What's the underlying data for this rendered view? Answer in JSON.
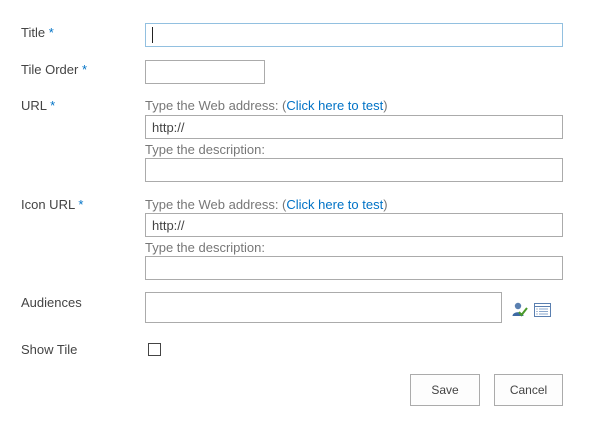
{
  "form": {
    "title": {
      "label": "Title",
      "required_mark": "*",
      "value": ""
    },
    "tile_order": {
      "label": "Tile Order",
      "required_mark": "*",
      "value": ""
    },
    "url": {
      "label": "URL",
      "required_mark": "*",
      "address_hint_prefix": "Type the Web address: (",
      "test_link": "Click here to test",
      "address_hint_suffix": ")",
      "address_value": "http://",
      "description_hint": "Type the description:",
      "description_value": ""
    },
    "icon_url": {
      "label": "Icon URL",
      "required_mark": "*",
      "address_hint_prefix": "Type the Web address: (",
      "test_link": "Click here to test",
      "address_hint_suffix": ")",
      "address_value": "http://",
      "description_hint": "Type the description:",
      "description_value": ""
    },
    "audiences": {
      "label": "Audiences",
      "value": ""
    },
    "show_tile": {
      "label": "Show Tile",
      "checked": false
    }
  },
  "actions": {
    "save_label": "Save",
    "cancel_label": "Cancel"
  },
  "colors": {
    "accent": "#0072c6",
    "border": "#ababab",
    "focus_border": "#92c0e0",
    "text": "#444444",
    "hint": "#777777"
  },
  "icons": {
    "check_names": "check-names-icon",
    "browse": "address-book-icon"
  }
}
